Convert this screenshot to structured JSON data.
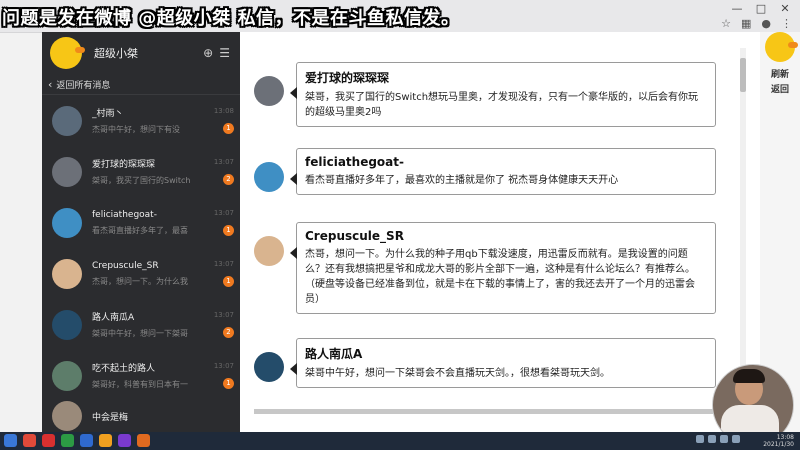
{
  "overlay": {
    "caption": "问题是发在微博 @超级小桀 私信，不是在斗鱼私信发。"
  },
  "window": {
    "minimize": "—",
    "maximize": "□",
    "close": "✕"
  },
  "sidebar": {
    "title": "超级小桀",
    "back_label": "返回所有消息",
    "items": [
      {
        "name": "_村雨丶",
        "preview": "杰哥中午好，想问下有没",
        "time": "13:08",
        "badge": "1",
        "avatar_color": "#5a6a7a"
      },
      {
        "name": "爱打球的琛琛琛",
        "preview": "桀哥，我买了国行的Switch",
        "time": "13:07",
        "badge": "2",
        "avatar_color": "#6c7078"
      },
      {
        "name": "feliciathegoat-",
        "preview": "看杰哥直播好多年了，最喜",
        "time": "13:07",
        "badge": "1",
        "avatar_color": "#3f8fc4"
      },
      {
        "name": "Crepuscule_SR",
        "preview": "杰哥，想问一下。为什么我",
        "time": "13:07",
        "badge": "1",
        "avatar_color": "#d9b48f"
      },
      {
        "name": "路人南瓜A",
        "preview": "桀哥中午好，想问一下桀哥",
        "time": "13:07",
        "badge": "2",
        "avatar_color": "#244c6a"
      },
      {
        "name": "吃不起土的路人",
        "preview": "桀哥好，科普有到日本有一",
        "time": "13:07",
        "badge": "1",
        "avatar_color": "#5d7d6a"
      },
      {
        "name": "中会是梅",
        "preview": "",
        "time": "",
        "badge": "",
        "avatar_color": "#9a8a7a"
      }
    ]
  },
  "messages": [
    {
      "name": "爱打球的琛琛琛",
      "body": "桀哥，我买了国行的Switch想玩马里奥，才发现没有，只有一个豪华版的，以后会有你玩的超级马里奥2吗",
      "avatar_color": "#6c7078"
    },
    {
      "name": "feliciathegoat-",
      "body": "看杰哥直播好多年了，最喜欢的主播就是你了 祝杰哥身体健康天天开心",
      "avatar_color": "#3f8fc4"
    },
    {
      "name": "Crepuscule_SR",
      "body": "杰哥，想问一下。为什么我的种子用qb下载没速度，用迅雷反而就有。是我设置的问题么？还有我想搞把星爷和成龙大哥的影片全部下一遍，这种是有什么论坛么？有推荐么。（硬盘等设备已经准备到位，就是卡在下载的事情上了，害的我还去开了一个月的迅雷会员）",
      "avatar_color": "#d9b48f"
    },
    {
      "name": "路人南瓜A",
      "body": "桀哥中午好，想问一下桀哥会不会直播玩天剑。，很想看桀哥玩天剑。",
      "avatar_color": "#244c6a"
    }
  ],
  "right_panel": {
    "refresh": "刷新",
    "back": "返回"
  },
  "taskbar": {
    "time": "13:08",
    "date": "2021/1/30"
  }
}
